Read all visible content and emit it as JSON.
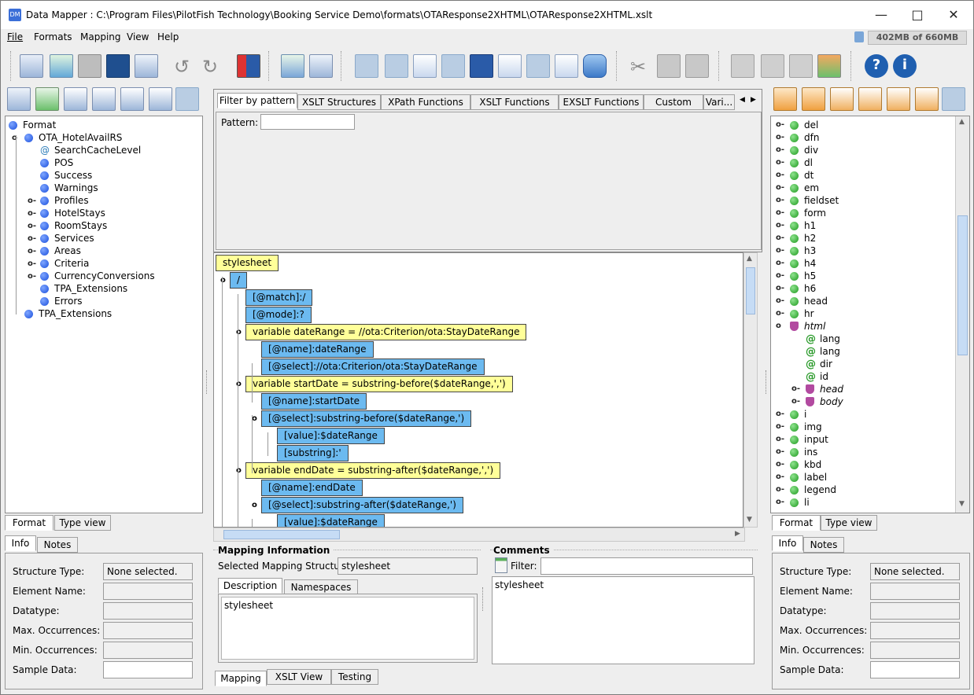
{
  "window": {
    "title": "Data Mapper : C:\\Program Files\\PilotFish Technology\\Booking Service Demo\\formats\\OTAResponse2XHTML\\OTAResponse2XHTML.xslt"
  },
  "menu": [
    "File",
    "Formats",
    "Mapping",
    "View",
    "Help"
  ],
  "memory": "402MB of 660MB",
  "left_tree": [
    {
      "label": "Format",
      "level": 0,
      "icon": "blue",
      "exp": ""
    },
    {
      "label": "OTA_HotelAvailRS",
      "level": 1,
      "icon": "blue",
      "exp": "open"
    },
    {
      "label": "SearchCacheLevel",
      "level": 2,
      "icon": "at",
      "exp": ""
    },
    {
      "label": "POS",
      "level": 2,
      "icon": "blue",
      "exp": ""
    },
    {
      "label": "Success",
      "level": 2,
      "icon": "blue",
      "exp": ""
    },
    {
      "label": "Warnings",
      "level": 2,
      "icon": "blue",
      "exp": ""
    },
    {
      "label": "Profiles",
      "level": 2,
      "icon": "blue",
      "exp": "closed"
    },
    {
      "label": "HotelStays",
      "level": 2,
      "icon": "blue",
      "exp": "closed"
    },
    {
      "label": "RoomStays",
      "level": 2,
      "icon": "blue",
      "exp": "closed"
    },
    {
      "label": "Services",
      "level": 2,
      "icon": "blue",
      "exp": "closed"
    },
    {
      "label": "Areas",
      "level": 2,
      "icon": "blue",
      "exp": "closed"
    },
    {
      "label": "Criteria",
      "level": 2,
      "icon": "blue",
      "exp": "closed"
    },
    {
      "label": "CurrencyConversions",
      "level": 2,
      "icon": "blue",
      "exp": "closed"
    },
    {
      "label": "TPA_Extensions",
      "level": 2,
      "icon": "blue",
      "exp": ""
    },
    {
      "label": "Errors",
      "level": 2,
      "icon": "blue",
      "exp": ""
    },
    {
      "label": "TPA_Extensions",
      "level": 1,
      "icon": "blue",
      "exp": ""
    }
  ],
  "left_tabs": [
    "Format",
    "Type view"
  ],
  "info_tabs": [
    "Info",
    "Notes"
  ],
  "info_fields": [
    {
      "label": "Structure Type:",
      "value": "None selected."
    },
    {
      "label": "Element Name:",
      "value": ""
    },
    {
      "label": "Datatype:",
      "value": ""
    },
    {
      "label": "Max. Occurrences:",
      "value": ""
    },
    {
      "label": "Min. Occurrences:",
      "value": ""
    },
    {
      "label": "Sample Data:",
      "value": ""
    }
  ],
  "function_tabs": [
    "Filter by pattern",
    "XSLT Structures",
    "XPath Functions",
    "XSLT Functions",
    "EXSLT Functions",
    "Custom",
    "Vari..."
  ],
  "pattern_label": "Pattern:",
  "xslt_tree": [
    {
      "label": "stylesheet",
      "color": "y",
      "level": 0
    },
    {
      "label": "/",
      "color": "b",
      "level": 1
    },
    {
      "label": "[@match]:/",
      "color": "b",
      "level": 2
    },
    {
      "label": "[@mode]:?",
      "color": "b",
      "level": 2
    },
    {
      "label": "variable dateRange = //ota:Criterion/ota:StayDateRange",
      "color": "y",
      "level": 2
    },
    {
      "label": "[@name]:dateRange",
      "color": "b",
      "level": 3
    },
    {
      "label": "[@select]://ota:Criterion/ota:StayDateRange",
      "color": "b",
      "level": 3
    },
    {
      "label": "variable startDate = substring-before($dateRange,',')",
      "color": "y",
      "level": 2
    },
    {
      "label": "[@name]:startDate",
      "color": "b",
      "level": 3
    },
    {
      "label": "[@select]:substring-before($dateRange,')",
      "color": "b",
      "level": 3
    },
    {
      "label": "[value]:$dateRange",
      "color": "b",
      "level": 4
    },
    {
      "label": "[substring]:'",
      "color": "b",
      "level": 4
    },
    {
      "label": "variable endDate = substring-after($dateRange,',')",
      "color": "y",
      "level": 2
    },
    {
      "label": "[@name]:endDate",
      "color": "b",
      "level": 3
    },
    {
      "label": "[@select]:substring-after($dateRange,')",
      "color": "b",
      "level": 3
    },
    {
      "label": "[value]:$dateRange",
      "color": "b",
      "level": 4
    }
  ],
  "mapping_info": {
    "title": "Mapping Information",
    "selected_label": "Selected Mapping Structure:",
    "selected_value": "stylesheet",
    "tabs": [
      "Description",
      "Namespaces"
    ],
    "description": "stylesheet"
  },
  "comments": {
    "title": "Comments",
    "filter_label": "Filter:",
    "text": "stylesheet"
  },
  "bottom_tabs": [
    "Mapping",
    "XSLT View",
    "Testing"
  ],
  "right_tree": [
    {
      "label": "del",
      "level": 0,
      "icon": "green",
      "exp": "closed",
      "italic": false
    },
    {
      "label": "dfn",
      "level": 0,
      "icon": "green",
      "exp": "closed",
      "italic": false
    },
    {
      "label": "div",
      "level": 0,
      "icon": "green",
      "exp": "closed",
      "italic": false
    },
    {
      "label": "dl",
      "level": 0,
      "icon": "green",
      "exp": "closed",
      "italic": false
    },
    {
      "label": "dt",
      "level": 0,
      "icon": "green",
      "exp": "closed",
      "italic": false
    },
    {
      "label": "em",
      "level": 0,
      "icon": "green",
      "exp": "closed",
      "italic": false
    },
    {
      "label": "fieldset",
      "level": 0,
      "icon": "green",
      "exp": "closed",
      "italic": false
    },
    {
      "label": "form",
      "level": 0,
      "icon": "green",
      "exp": "closed",
      "italic": false
    },
    {
      "label": "h1",
      "level": 0,
      "icon": "green",
      "exp": "closed",
      "italic": false
    },
    {
      "label": "h2",
      "level": 0,
      "icon": "green",
      "exp": "closed",
      "italic": false
    },
    {
      "label": "h3",
      "level": 0,
      "icon": "green",
      "exp": "closed",
      "italic": false
    },
    {
      "label": "h4",
      "level": 0,
      "icon": "green",
      "exp": "closed",
      "italic": false
    },
    {
      "label": "h5",
      "level": 0,
      "icon": "green",
      "exp": "closed",
      "italic": false
    },
    {
      "label": "h6",
      "level": 0,
      "icon": "green",
      "exp": "closed",
      "italic": false
    },
    {
      "label": "head",
      "level": 0,
      "icon": "green",
      "exp": "closed",
      "italic": false
    },
    {
      "label": "hr",
      "level": 0,
      "icon": "green",
      "exp": "closed",
      "italic": false
    },
    {
      "label": "html",
      "level": 0,
      "icon": "shield",
      "exp": "open",
      "italic": true
    },
    {
      "label": "lang",
      "level": 1,
      "icon": "at",
      "exp": "",
      "italic": false
    },
    {
      "label": "lang",
      "level": 1,
      "icon": "at",
      "exp": "",
      "italic": false
    },
    {
      "label": "dir",
      "level": 1,
      "icon": "at",
      "exp": "",
      "italic": false
    },
    {
      "label": "id",
      "level": 1,
      "icon": "at",
      "exp": "",
      "italic": false
    },
    {
      "label": "head",
      "level": 1,
      "icon": "shield",
      "exp": "closed",
      "italic": true
    },
    {
      "label": "body",
      "level": 1,
      "icon": "shield",
      "exp": "closed",
      "italic": true
    },
    {
      "label": "i",
      "level": 0,
      "icon": "green",
      "exp": "closed",
      "italic": false
    },
    {
      "label": "img",
      "level": 0,
      "icon": "green",
      "exp": "closed",
      "italic": false
    },
    {
      "label": "input",
      "level": 0,
      "icon": "green",
      "exp": "closed",
      "italic": false
    },
    {
      "label": "ins",
      "level": 0,
      "icon": "green",
      "exp": "closed",
      "italic": false
    },
    {
      "label": "kbd",
      "level": 0,
      "icon": "green",
      "exp": "closed",
      "italic": false
    },
    {
      "label": "label",
      "level": 0,
      "icon": "green",
      "exp": "closed",
      "italic": false
    },
    {
      "label": "legend",
      "level": 0,
      "icon": "green",
      "exp": "closed",
      "italic": false
    },
    {
      "label": "li",
      "level": 0,
      "icon": "green",
      "exp": "closed",
      "italic": false
    }
  ],
  "right_tabs": [
    "Format",
    "Type view"
  ],
  "colors": {
    "node_yellow": "#ffff99",
    "node_blue": "#6cbaf0",
    "selected_tool": "#b9cde3"
  }
}
